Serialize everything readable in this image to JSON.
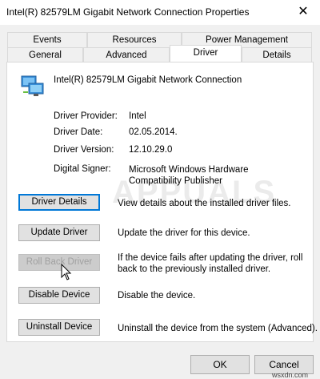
{
  "window": {
    "title": "Intel(R) 82579LM Gigabit Network Connection Properties",
    "close_glyph": "✕"
  },
  "tabs_row1": [
    "Events",
    "Resources",
    "Power Management"
  ],
  "tabs_row2": [
    "General",
    "Advanced",
    "Driver",
    "Details"
  ],
  "selected_tab": "Driver",
  "device": {
    "name": "Intel(R) 82579LM Gigabit Network Connection",
    "icon": "network-adapter-icon"
  },
  "properties": {
    "provider_label": "Driver Provider:",
    "provider_value": "Intel",
    "date_label": "Driver Date:",
    "date_value": "02.05.2014.",
    "version_label": "Driver Version:",
    "version_value": "12.10.29.0",
    "signer_label": "Digital Signer:",
    "signer_value": "Microsoft Windows Hardware Compatibility Publisher"
  },
  "actions": {
    "details_label": "Driver Details",
    "details_desc": "View details about the installed driver files.",
    "update_label": "Update Driver",
    "update_desc": "Update the driver for this device.",
    "rollback_label": "Roll Back Driver",
    "rollback_desc": "If the device fails after updating the driver, roll back to the previously installed driver.",
    "disable_label": "Disable Device",
    "disable_desc": "Disable the device.",
    "uninstall_label": "Uninstall Device",
    "uninstall_desc": "Uninstall the device from the system (Advanced)."
  },
  "footer": {
    "ok_label": "OK",
    "cancel_label": "Cancel"
  },
  "watermark_text": "APPUALS",
  "corner_watermark": "wsxdn.com",
  "colors": {
    "focus_border": "#0078d7",
    "dialog_bg": "#f0f0f0",
    "disabled_text": "#a0a0a0"
  }
}
